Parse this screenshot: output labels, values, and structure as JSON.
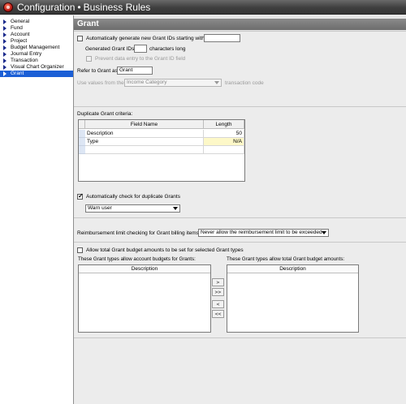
{
  "window": {
    "app_name": "Configuration",
    "separator": "•",
    "section": "Business Rules"
  },
  "sidebar": {
    "items": [
      {
        "label": "General"
      },
      {
        "label": "Fund"
      },
      {
        "label": "Account"
      },
      {
        "label": "Project"
      },
      {
        "label": "Budget Management"
      },
      {
        "label": "Journal Entry"
      },
      {
        "label": "Transaction"
      },
      {
        "label": "Visual Chart Organizer"
      },
      {
        "label": "Grant",
        "selected": true
      }
    ]
  },
  "panel": {
    "title": "Grant"
  },
  "id_settings": {
    "auto_generate_label": "Automatically generate new Grant IDs starting with",
    "auto_generate_checked": false,
    "start_value": "",
    "generated_ids_label": "Generated Grant IDs",
    "length_value": "",
    "characters_long_label": "characters long",
    "prevent_entry_label": "Prevent data entry to the Grant ID field",
    "prevent_entry_checked": false,
    "refer_label": "Refer to Grant as",
    "refer_value": "Grant",
    "use_values_label": "Use values from the",
    "use_values_select": "Income Category",
    "transaction_code_label": "transaction code"
  },
  "duplicate_criteria": {
    "label": "Duplicate Grant criteria:",
    "columns": [
      "Field Name",
      "Length"
    ],
    "rows": [
      {
        "field": "Description",
        "length": "50"
      },
      {
        "field": "Type",
        "length": "N/A"
      },
      {
        "field": "",
        "length": ""
      }
    ],
    "auto_check_label": "Automatically check for duplicate Grants",
    "auto_check_checked": true,
    "action_select": "Warn user"
  },
  "reimbursement": {
    "label": "Reimbursement limit checking for Grant billing items:",
    "select": "Never allow the reimbursement limit to be exceeded"
  },
  "budget_amounts": {
    "allow_label": "Allow total Grant budget amounts to be set for selected Grant types",
    "allow_checked": false,
    "left_list_label": "These Grant types allow account budgets for Grants:",
    "right_list_label": "These Grant types allow total Grant budget amounts:",
    "left_column": "Description",
    "right_column": "Description",
    "buttons": {
      "move_one_right": ">",
      "move_all_right": ">>",
      "move_one_left": "<",
      "move_all_left": "<<"
    }
  },
  "colors": {
    "title_bar": "#4a4a4a",
    "panel_header": "#7a7a7a",
    "selection": "#1b5fd6",
    "highlight_cell": "#fdf8c8"
  }
}
